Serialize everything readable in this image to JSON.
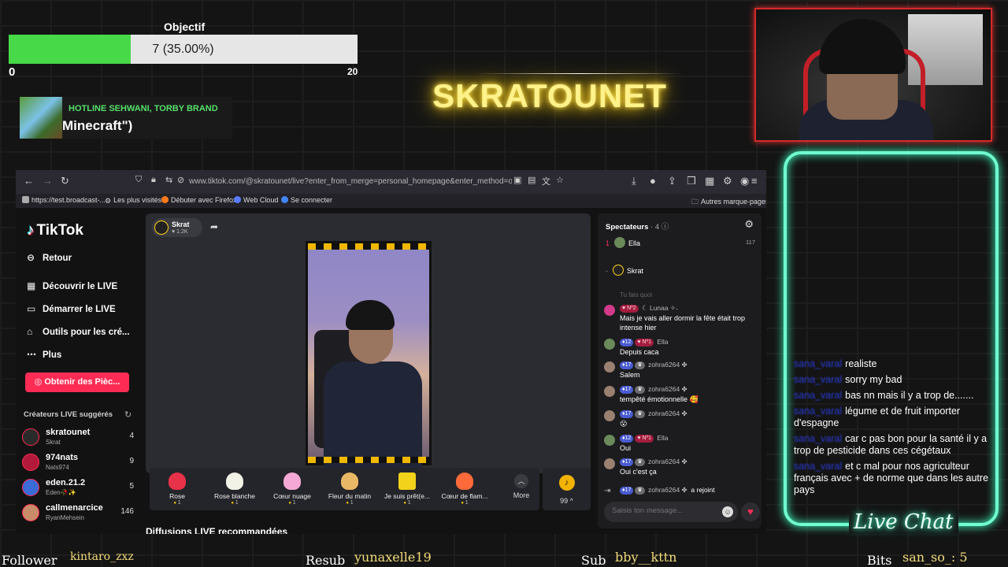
{
  "goal": {
    "title": "Objectif",
    "progress_text": "7 (35.00%)",
    "progress_fraction": 0.35,
    "min": "0",
    "max": "20",
    "fill_color": "#48d948"
  },
  "now_playing": {
    "artist": "HOTLINE SEHWANI, TORBY BRAND",
    "title": "Minecraft\")"
  },
  "streamer_name": "SKRATOUNET",
  "browser": {
    "url": "www.tiktok.com/@skratounet/live?enter_from_merge=personal_homepage&enter_method=others_p",
    "bookmarks": [
      "https://test.broadcast-...",
      "Les plus visités",
      "Débuter avec Firefox",
      "Web Cloud",
      "Se connecter"
    ],
    "other_bookmarks": "Autres marque-pages"
  },
  "tiktok": {
    "logo": "TikTok",
    "back": "Retour",
    "nav": [
      "Découvrir le LIVE",
      "Démarrer le LIVE",
      "Outils pour les cré...",
      "Plus"
    ],
    "coins_button": "Obtenir des Pièc...",
    "creators_title": "Créateurs LIVE suggérés",
    "creators": [
      {
        "name": "skratounet",
        "sub": "Skrat",
        "count": "4",
        "color": "#2a2a2a"
      },
      {
        "name": "974nats",
        "sub": "Nats974",
        "count": "9",
        "color": "#b3193a"
      },
      {
        "name": "eden.21.2",
        "sub": "Eden🥀✨",
        "count": "5",
        "color": "#3a6bd6"
      },
      {
        "name": "callmenarcice",
        "sub": "RyanMehsein",
        "count": "146",
        "color": "#c98c6a"
      }
    ],
    "host": {
      "name": "Skrat",
      "likes": "♥ 1.2K"
    },
    "gifts": [
      {
        "name": "Rose",
        "price": "1",
        "icon": "rose-gift-icon",
        "color": "#e8324a"
      },
      {
        "name": "Rose blanche",
        "price": "1",
        "icon": "white-rose-gift-icon",
        "color": "#f2f2e6"
      },
      {
        "name": "Cœur nuage",
        "price": "1",
        "icon": "cloud-heart-gift-icon",
        "color": "#f5a8d6"
      },
      {
        "name": "Fleur du matin",
        "price": "1",
        "icon": "flower-gift-icon",
        "color": "#e9b866"
      },
      {
        "name": "Je suis prêt(e...",
        "price": "1",
        "icon": "sponge-gift-icon",
        "color": "#f2d21a"
      },
      {
        "name": "Cœur de flam...",
        "price": "1",
        "icon": "flame-heart-gift-icon",
        "color": "#ff6a3a"
      }
    ],
    "more_label": "More",
    "coin_count": "99 ^",
    "recommended": "Diffusions LIVE recommandées"
  },
  "chat": {
    "header": "Spectateurs",
    "viewer_count": "· 4",
    "top_viewers": [
      {
        "rank": "1",
        "name": "Ella",
        "score": "117"
      },
      {
        "rank": "-",
        "name": "Skrat"
      }
    ],
    "faded_text": "Tu fais quoi",
    "messages": [
      {
        "user": "☾ Lunaa ✧˖",
        "badges": [
          {
            "t": "top",
            "v": "♥ Nº2"
          }
        ],
        "text": "Mais je vais aller dormir la fête était trop intense hier",
        "color": "#d23a8a"
      },
      {
        "user": "Ella",
        "badges": [
          {
            "t": "lvl",
            "v": "♦12"
          },
          {
            "t": "top",
            "v": "♥ Nº1"
          }
        ],
        "text": "Depuis caca",
        "color": "#6a8a5a"
      },
      {
        "user": "zohra6264 ✤",
        "badges": [
          {
            "t": "lvl",
            "v": "♦17"
          },
          {
            "t": "fan",
            "v": "♛"
          }
        ],
        "text": "Salem",
        "color": "#9a8070"
      },
      {
        "user": "zohra6264 ✤",
        "badges": [
          {
            "t": "lvl",
            "v": "♦17"
          },
          {
            "t": "fan",
            "v": "♛"
          }
        ],
        "text": "tempêté émotionnelle 🥰",
        "color": "#9a8070"
      },
      {
        "user": "zohra6264 ✤",
        "badges": [
          {
            "t": "lvl",
            "v": "♦17"
          },
          {
            "t": "fan",
            "v": "♛"
          }
        ],
        "text": "😮",
        "color": "#9a8070"
      },
      {
        "user": "Ella",
        "badges": [
          {
            "t": "lvl",
            "v": "♦12"
          },
          {
            "t": "top",
            "v": "♥ Nº1"
          }
        ],
        "text": "Oui",
        "color": "#6a8a5a"
      },
      {
        "user": "zohra6264 ✤",
        "badges": [
          {
            "t": "lvl",
            "v": "♦17"
          },
          {
            "t": "fan",
            "v": "♛"
          }
        ],
        "text": "Oui c'est ça",
        "color": "#9a8070"
      }
    ],
    "join_notice": {
      "user": "zohra6264 ✤",
      "text": "a rejoint"
    },
    "input_placeholder": "Saisis ton message..."
  },
  "live_chat": {
    "title": "Live Chat",
    "messages": [
      {
        "user": "sana_varal",
        "text": "realiste"
      },
      {
        "user": "sana_varal",
        "text": "sorry my bad"
      },
      {
        "user": "sana_varal",
        "text": "bas nn mais il y a trop de......."
      },
      {
        "user": "sana_varal",
        "text": "légume et de fruit importer d'espagne"
      },
      {
        "user": "sana_varal",
        "text": "car c pas bon pour la santé il y a trop de pesticide dans ces cégétaux"
      },
      {
        "user": "sana_varal",
        "text": "et c mal pour nos agriculteur français avec + de norme que dans les autre pays"
      }
    ]
  },
  "footer": {
    "follower_label": "Follower",
    "follower_value": "kintaro_zxz",
    "resub_label": "Resub",
    "resub_value": "yunaxelle19",
    "sub_label": "Sub",
    "sub_value": "bby__kttn",
    "bits_label": "Bits",
    "bits_value": "san_so_: 5"
  }
}
